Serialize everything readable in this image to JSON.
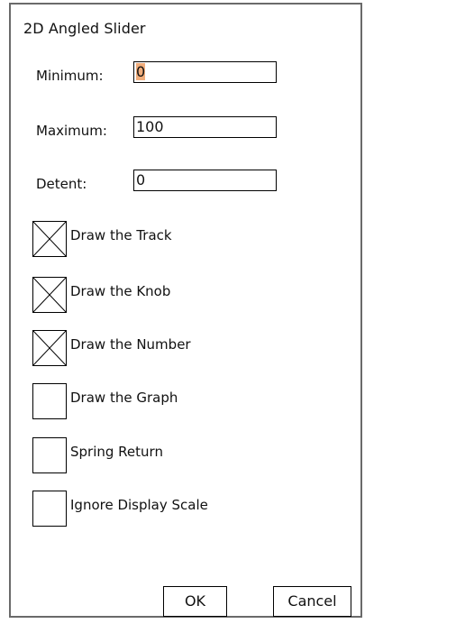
{
  "dialog": {
    "title": "2D Angled Slider"
  },
  "fields": [
    {
      "label": "Minimum:",
      "value": "0",
      "selected": true
    },
    {
      "label": "Maximum:",
      "value": "100",
      "selected": false
    },
    {
      "label": "Detent:",
      "value": "0",
      "selected": false
    }
  ],
  "checkboxes": [
    {
      "label": "Draw the Track",
      "checked": true
    },
    {
      "label": "Draw the Knob",
      "checked": true
    },
    {
      "label": "Draw the Number",
      "checked": true
    },
    {
      "label": "Draw the Graph",
      "checked": false
    },
    {
      "label": "Spring Return",
      "checked": false
    },
    {
      "label": "Ignore Display Scale",
      "checked": false
    }
  ],
  "buttons": {
    "ok_label": "OK",
    "cancel_label": "Cancel"
  },
  "colors": {
    "selection_highlight": "#f0ad7c",
    "border": "#6a6a6a"
  }
}
